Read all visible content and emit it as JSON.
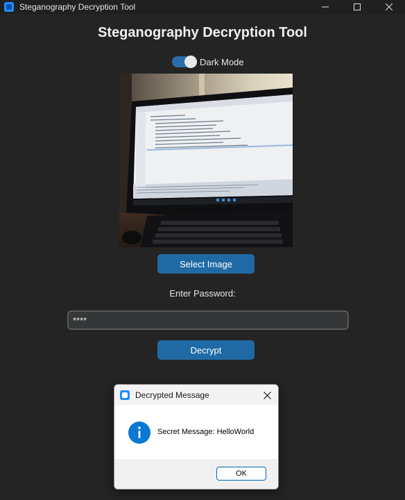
{
  "window": {
    "title": "Steganography Decryption Tool",
    "icon": "app-icon"
  },
  "main": {
    "heading": "Steganography Decryption Tool",
    "dark_mode_label": "Dark Mode",
    "dark_mode_on": true,
    "select_image_label": "Select Image",
    "password_label": "Enter Password:",
    "password_value": "****",
    "decrypt_label": "Decrypt"
  },
  "dialog": {
    "title": "Decrypted Message",
    "message": "Secret Message: HelloWorld",
    "ok_label": "OK",
    "icon": "info-icon"
  },
  "colors": {
    "background": "#242424",
    "accent": "#1f6aa5",
    "switch_track": "#2c6eaa"
  }
}
